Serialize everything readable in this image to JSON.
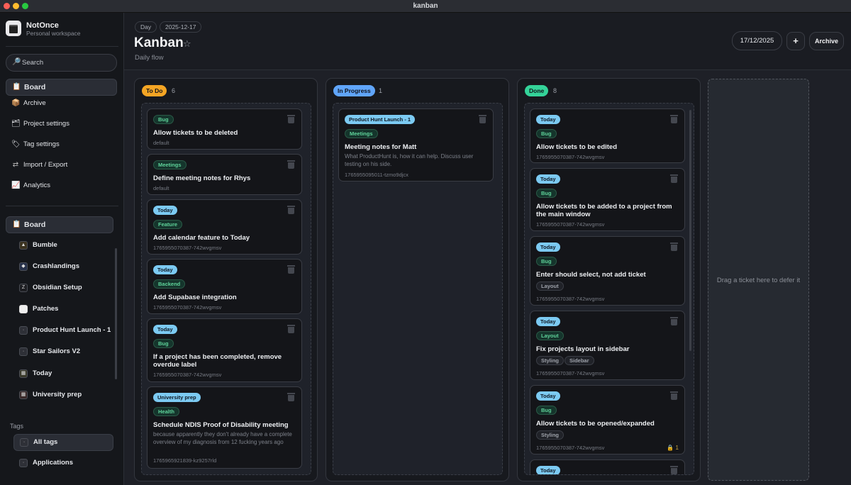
{
  "window": {
    "title": "kanban"
  },
  "workspace": {
    "name": "NotOnce",
    "subtitle": "Personal workspace"
  },
  "search": {
    "placeholder": "Search",
    "icon": "magnifier-icon"
  },
  "nav": [
    {
      "label": "Board",
      "icon": "clipboard-icon",
      "active": true
    },
    {
      "label": "Archive",
      "icon": "package-icon"
    },
    {
      "label": "Project settings",
      "icon": "folder-icon"
    },
    {
      "label": "Tag settings",
      "icon": "tag-icon"
    },
    {
      "label": "Import / Export",
      "icon": "arrows-icon"
    },
    {
      "label": "Analytics",
      "icon": "chart-icon"
    }
  ],
  "projects_section": {
    "board_label": "Board"
  },
  "projects": [
    {
      "label": "Bumble",
      "icon": "bee-icon"
    },
    {
      "label": "Crashlandings",
      "icon": "shield-icon"
    },
    {
      "label": "Obsidian Setup",
      "icon": "z-icon"
    },
    {
      "label": "Patches",
      "icon": "square-icon"
    },
    {
      "label": "Product Hunt Launch - 1",
      "icon": "dot-icon"
    },
    {
      "label": "Star Sailors V2",
      "icon": "dot-icon"
    },
    {
      "label": "Today",
      "icon": "calendar-icon"
    },
    {
      "label": "University prep",
      "icon": "calendar-icon"
    }
  ],
  "tags_section": {
    "title": "Tags",
    "items": [
      {
        "label": "All tags"
      },
      {
        "label": "Applications"
      }
    ]
  },
  "header": {
    "pill_view": "Day",
    "pill_date": "2025-12-17",
    "title": "Kanban",
    "subtitle": "Daily flow",
    "date_button": "17/12/2025",
    "add_button": "+",
    "archive_button": "Archive"
  },
  "columns": [
    {
      "name": "To Do",
      "count": "6",
      "color": "#f59e0b",
      "cards": [
        {
          "tags": [
            {
              "text": "Bug",
              "style": "green"
            }
          ],
          "title": "Allow tickets to be deleted",
          "meta": "default"
        },
        {
          "tags": [
            {
              "text": "Meetings",
              "style": "green"
            }
          ],
          "title": "Define meeting notes for Rhys",
          "meta": "default"
        },
        {
          "tags": [
            {
              "text": "Today",
              "style": "blue"
            },
            {
              "text": "Feature",
              "style": "green"
            }
          ],
          "title": "Add calendar feature to Today",
          "meta": "1765955070387-742wvgmsv"
        },
        {
          "tags": [
            {
              "text": "Today",
              "style": "blue"
            },
            {
              "text": "Backend",
              "style": "green"
            }
          ],
          "title": "Add Supabase integration",
          "meta": "1765955070387-742wvgmsv"
        },
        {
          "tags": [
            {
              "text": "Today",
              "style": "blue"
            },
            {
              "text": "Bug",
              "style": "green"
            }
          ],
          "title": "If a project has been completed, remove overdue label",
          "meta": "1765955070387-742wvgmsv"
        },
        {
          "tags": [
            {
              "text": "University prep",
              "style": "blue"
            },
            {
              "text": "Health",
              "style": "green"
            }
          ],
          "title": "Schedule NDIS Proof of Disability meeting",
          "desc": "because apparently they don't already have a complete overview of my diagnosis from 12 fucking years ago",
          "meta": "1765965921839-kz9257rld"
        }
      ]
    },
    {
      "name": "In Progress",
      "count": "1",
      "color": "#60a5fa",
      "cards": [
        {
          "tags": [
            {
              "text": "Product Hunt Launch - 1",
              "style": "blue"
            },
            {
              "text": "Meetings",
              "style": "green"
            }
          ],
          "title": "Meeting notes for Matt",
          "desc": "What ProductHunt is, how it can help. Discuss user testing on his side.",
          "meta": "1765955095011-tzmo9djcx"
        }
      ]
    },
    {
      "name": "Done",
      "count": "8",
      "color": "#34d399",
      "cards": [
        {
          "tags": [
            {
              "text": "Today",
              "style": "blue"
            },
            {
              "text": "Bug",
              "style": "green"
            }
          ],
          "title": "Allow tickets to be edited",
          "meta": "1765955070387-742wvgmsv"
        },
        {
          "tags": [
            {
              "text": "Today",
              "style": "blue"
            },
            {
              "text": "Bug",
              "style": "green"
            }
          ],
          "title": "Allow tickets to be added to a project from the main window",
          "meta": "1765955070387-742wvgmsv"
        },
        {
          "tags": [
            {
              "text": "Today",
              "style": "blue"
            },
            {
              "text": "Bug",
              "style": "green"
            }
          ],
          "extra_tags": [
            "Layout"
          ],
          "title": "Enter should select, not add ticket",
          "meta": "1765955070387-742wvgmsv"
        },
        {
          "tags": [
            {
              "text": "Today",
              "style": "blue"
            },
            {
              "text": "Layout",
              "style": "green"
            }
          ],
          "extra_tags": [
            "Styling",
            "Sidebar"
          ],
          "title": "Fix projects layout in sidebar",
          "meta": "1765955070387-742wvgmsv"
        },
        {
          "tags": [
            {
              "text": "Today",
              "style": "blue"
            },
            {
              "text": "Bug",
              "style": "green"
            }
          ],
          "extra_tags": [
            "Styling"
          ],
          "title": "Allow tickets to be opened/expanded",
          "meta": "1765955070387-742wvgmsv",
          "lock_count": "1"
        },
        {
          "tags": [
            {
              "text": "Today",
              "style": "blue"
            }
          ],
          "title": "",
          "meta": ""
        }
      ]
    }
  ],
  "defer_zone": {
    "text": "Drag a ticket here to defer it"
  }
}
